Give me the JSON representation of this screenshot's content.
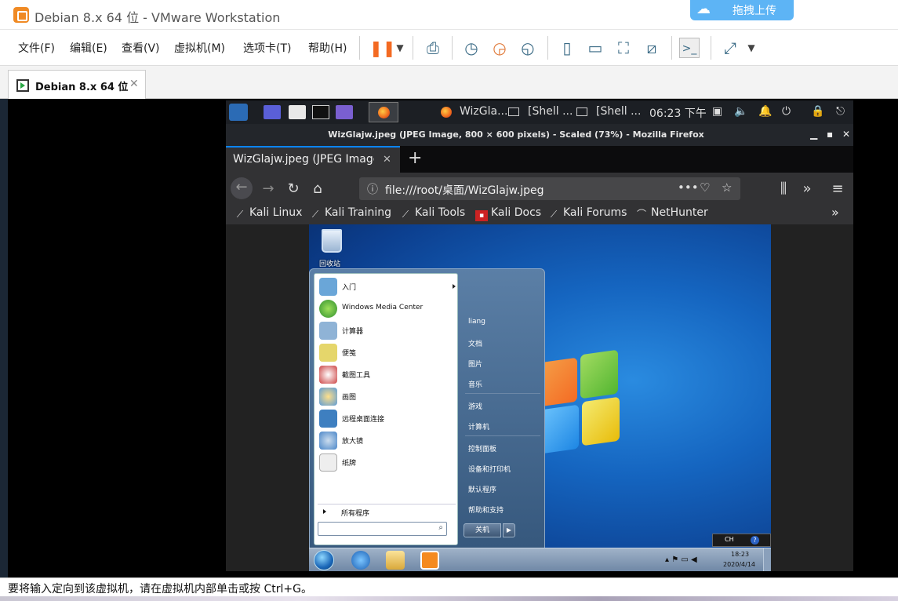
{
  "vmware": {
    "window_title": "Debian 8.x 64 位 - VMware Workstation",
    "upload_button": "拖拽上传",
    "menu": [
      "文件(F)",
      "编辑(E)",
      "查看(V)",
      "虚拟机(M)",
      "选项卡(T)",
      "帮助(H)"
    ],
    "tab_label": "Debian 8.x 64 位",
    "status_text": "要将输入定向到该虚拟机，请在虚拟机内部单击或按 Ctrl+G。"
  },
  "kali_panel": {
    "task_firefox": "WizGla...",
    "task_shell1": "[Shell ...",
    "task_shell2": "[Shell ...",
    "clock": "06:23 下午"
  },
  "firefox": {
    "window_title": "WizGlajw.jpeg (JPEG Image, 800 × 600 pixels) - Scaled (73%) - Mozilla Firefox",
    "tab_title": "WizGlajw.jpeg (JPEG Image",
    "url": "file:///root/桌面/WizGlajw.jpeg",
    "bookmarks": [
      "Kali Linux",
      "Kali Training",
      "Kali Tools",
      "Kali Docs",
      "Kali Forums",
      "NetHunter"
    ]
  },
  "win7": {
    "recycle_bin": "回收站",
    "start_left": [
      {
        "label": "入门",
        "color": "#6aa6d8"
      },
      {
        "label": "Windows Media Center",
        "color": "#3a9b3a"
      },
      {
        "label": "计算器",
        "color": "#8fb3d6"
      },
      {
        "label": "便笺",
        "color": "#e5d66b"
      },
      {
        "label": "截图工具",
        "color": "#c44"
      },
      {
        "label": "画图",
        "color": "#5c9bd6"
      },
      {
        "label": "远程桌面连接",
        "color": "#3e7fc0"
      },
      {
        "label": "放大镜",
        "color": "#4a86c8"
      },
      {
        "label": "纸牌",
        "color": "#ddd"
      }
    ],
    "all_programs": "所有程序",
    "start_right": [
      "liang",
      "文档",
      "图片",
      "音乐",
      "游戏",
      "计算机",
      "控制面板",
      "设备和打印机",
      "默认程序",
      "帮助和支持"
    ],
    "shutdown": "关机",
    "lang": "CH",
    "time": "18:23",
    "date": "2020/4/14"
  }
}
